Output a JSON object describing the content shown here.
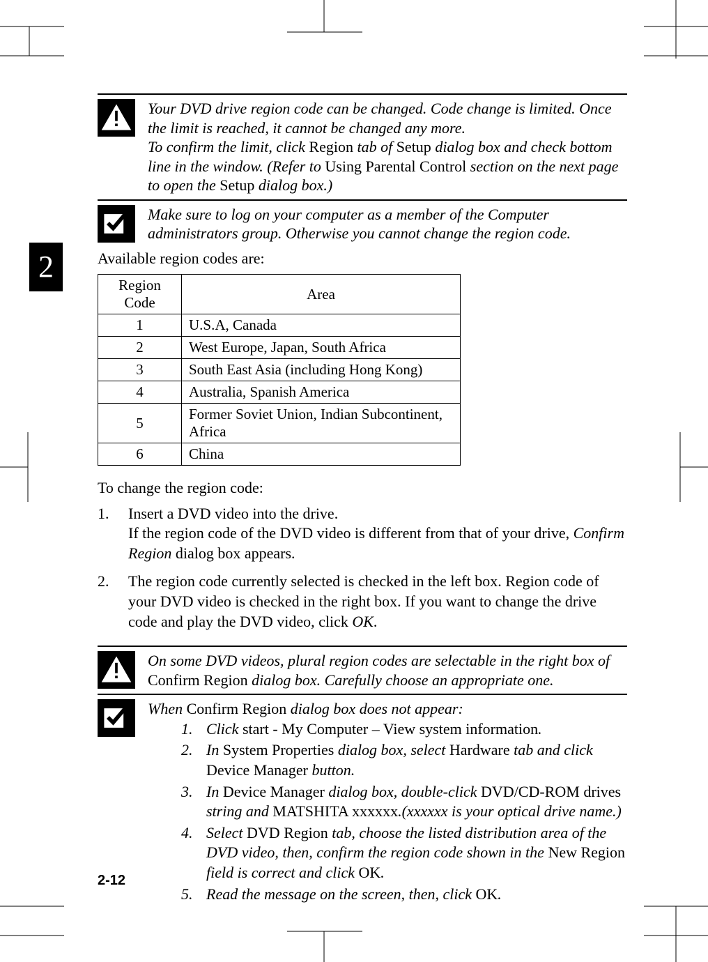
{
  "chapter_number": "2",
  "page_number": "2-12",
  "warning1": {
    "line1_a": "Your DVD drive region code can be changed. Code change is limited. Once the limit is reached, it cannot be changed any more.",
    "line2_a": "To confirm the limit, click ",
    "line2_r1": "Region",
    "line2_b": " tab of ",
    "line2_r2": "Setup",
    "line2_c": " dialog box and check bottom line in the window. (Refer to ",
    "line2_r3": "Using Parental Control",
    "line2_d": " section on the next page to open the ",
    "line2_r4": "Setup",
    "line2_e": " dialog box.)"
  },
  "check1": "Make sure to log on your computer as a member of the Computer administrators group. Otherwise you cannot change the region code.",
  "available_label": "Available region codes are:",
  "table_headers": {
    "code": "Region Code",
    "area": "Area"
  },
  "regions": [
    {
      "code": "1",
      "area": "U.S.A, Canada"
    },
    {
      "code": "2",
      "area": "West Europe, Japan, South Africa"
    },
    {
      "code": "3",
      "area": "South East Asia (including Hong Kong)"
    },
    {
      "code": "4",
      "area": "Australia, Spanish America"
    },
    {
      "code": "5",
      "area": "Former Soviet Union, Indian Subcontinent, Africa"
    },
    {
      "code": "6",
      "area": "China"
    }
  ],
  "change_label": "To change the region code:",
  "steps": {
    "s1_a": "Insert a DVD video into the drive.",
    "s1_b_a": "If the region code of the DVD video is different from that of your drive, ",
    "s1_b_i": "Confirm Region",
    "s1_b_c": " dialog box appears.",
    "s2_a": "The region code currently selected is checked in the left box. Region code of your DVD video is checked in the right box. If you want to change the drive code and play the DVD video, click ",
    "s2_i": "OK",
    "s2_b": "."
  },
  "warning2_a": "On some DVD videos, plural region codes are selectable in the right box of ",
  "warning2_r": "Confirm Region",
  "warning2_b": " dialog box. Carefully choose an appropriate one.",
  "check2_intro_a": "When ",
  "check2_intro_r": "Confirm Region",
  "check2_intro_b": " dialog box does not appear:",
  "sub": {
    "s1_a": "Click ",
    "s1_r": "start  - My Computer – View system information",
    "s1_b": ".",
    "s2_a": "In ",
    "s2_r1": "System Properties",
    "s2_b": " dialog box, select ",
    "s2_r2": "Hardware",
    "s2_c": " tab and click ",
    "s2_r3": "Device Manager",
    "s2_d": " button.",
    "s3_a": "In ",
    "s3_r1": "Device Manager",
    "s3_b": " dialog box, double-click ",
    "s3_r2": "DVD/CD-ROM drives",
    "s3_c": " string and ",
    "s3_r3": "MATSHITA xxxxxx",
    "s3_d": ".(xxxxxx is your optical drive name.)",
    "s4_a": "Select ",
    "s4_r1": "DVD Region",
    "s4_b": " tab, choose the listed distribution area of the DVD video, then, confirm the region code shown in the ",
    "s4_r2": "New Region",
    "s4_c": " field is correct and click ",
    "s4_r3": "OK",
    "s4_d": ".",
    "s5_a": "Read the message on the screen, then, click ",
    "s5_r": "OK",
    "s5_b": "."
  }
}
